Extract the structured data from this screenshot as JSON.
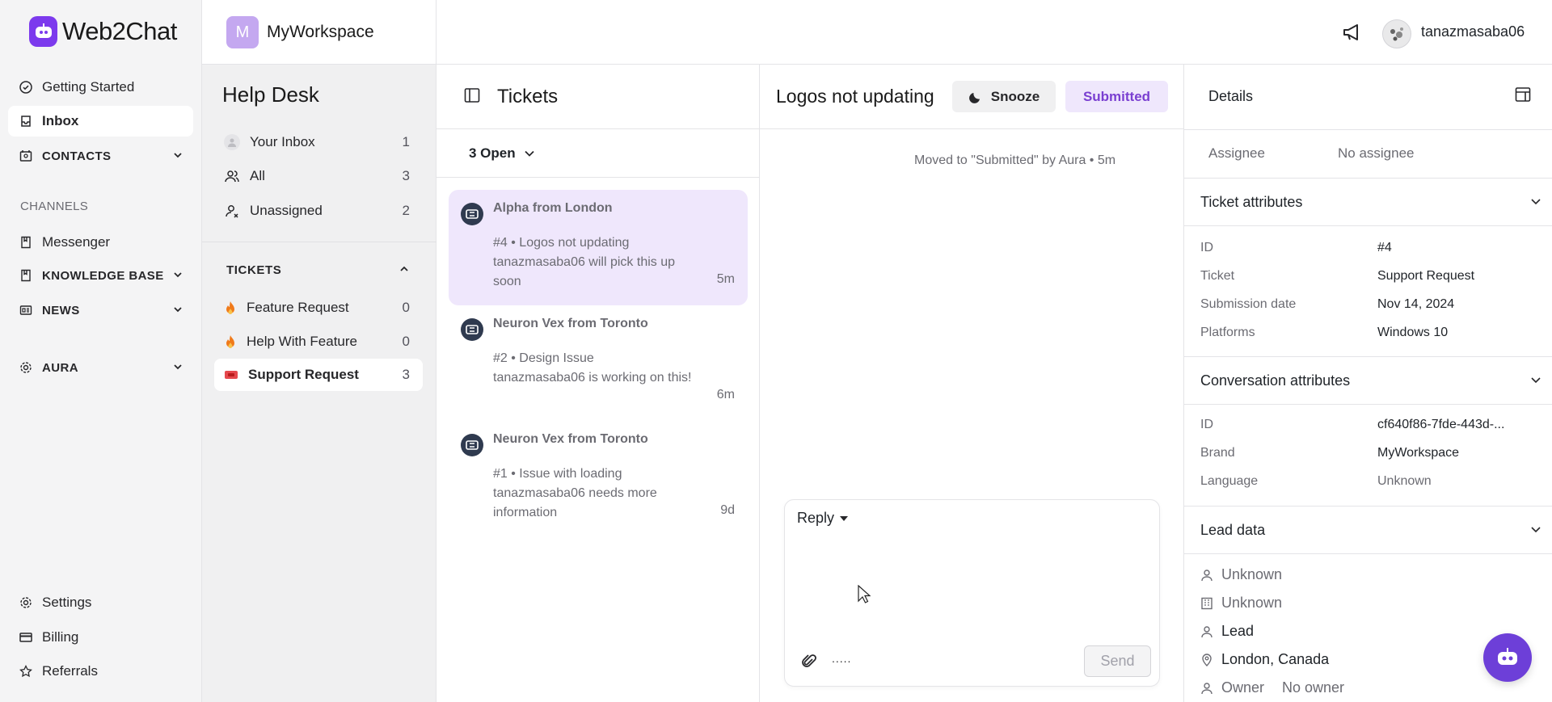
{
  "app": {
    "brand": "Web2Chat",
    "workspace_initial": "M",
    "workspace_name": "MyWorkspace",
    "username": "tanazmasaba06"
  },
  "nav": {
    "getting_started": "Getting Started",
    "inbox": "Inbox",
    "contacts": "CONTACTS",
    "channels_label": "CHANNELS",
    "messenger": "Messenger",
    "knowledge_base": "KNOWLEDGE BASE",
    "news": "NEWS",
    "aura": "AURA",
    "settings": "Settings",
    "billing": "Billing",
    "referrals": "Referrals"
  },
  "helpdesk": {
    "title": "Help Desk",
    "items": [
      {
        "label": "Your Inbox",
        "count": "1"
      },
      {
        "label": "All",
        "count": "3"
      },
      {
        "label": "Unassigned",
        "count": "2"
      }
    ],
    "tickets_label": "TICKETS",
    "ticket_types": [
      {
        "label": "Feature Request",
        "count": "0"
      },
      {
        "label": "Help With Feature",
        "count": "0"
      },
      {
        "label": "Support Request",
        "count": "3"
      }
    ]
  },
  "tickets": {
    "title": "Tickets",
    "filter": "3 Open",
    "list": [
      {
        "who": "Alpha from London",
        "line1": "#4 • Logos not updating",
        "line2": "tanazmasaba06 will pick this up soon",
        "time": "5m"
      },
      {
        "who": "Neuron Vex from Toronto",
        "line1": "#2 • Design Issue",
        "line2": "tanazmasaba06 is working on this!",
        "time": "6m"
      },
      {
        "who": "Neuron Vex from Toronto",
        "line1": "#1 • Issue with loading",
        "line2": "tanazmasaba06 needs more information",
        "time": "9d"
      }
    ]
  },
  "conversation": {
    "title": "Logos not updating",
    "snooze": "Snooze",
    "status": "Submitted",
    "event": "Moved to \"Submitted\" by Aura • 5m",
    "reply_mode": "Reply",
    "send": "Send",
    "more": "....."
  },
  "details": {
    "title": "Details",
    "assignee_label": "Assignee",
    "assignee_value": "No assignee",
    "ticket_attributes": "Ticket attributes",
    "ticket_rows": [
      {
        "k": "ID",
        "v": "#4"
      },
      {
        "k": "Ticket",
        "v": "Support Request"
      },
      {
        "k": "Submission date",
        "v": "Nov 14, 2024"
      },
      {
        "k": "Platforms",
        "v": "Windows 10"
      }
    ],
    "conversation_attributes": "Conversation attributes",
    "conversation_rows": [
      {
        "k": "ID",
        "v": "cf640f86-7fde-443d-..."
      },
      {
        "k": "Brand",
        "v": "MyWorkspace"
      },
      {
        "k": "Language",
        "v": "Unknown"
      }
    ],
    "lead_data": "Lead data",
    "lead_rows": [
      {
        "v": "Unknown"
      },
      {
        "v": "Unknown"
      },
      {
        "v": "Lead"
      },
      {
        "v": "London, Canada"
      }
    ],
    "owner_label": "Owner",
    "owner_value": "No owner"
  },
  "colors": {
    "accent": "#7c3aed",
    "status_bg": "#efe7fc",
    "status_text": "#7a3fd1",
    "ticket_red": "#e5484d",
    "flame": "#f07a1a"
  }
}
